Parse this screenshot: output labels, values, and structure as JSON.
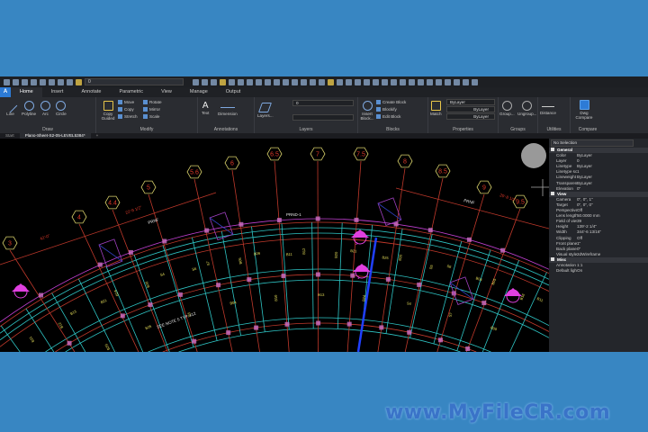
{
  "quick_access": {
    "layer_value": "0"
  },
  "ribbon_tabs": [
    "Home",
    "Insert",
    "Annotate",
    "Parametric",
    "View",
    "Manage",
    "Output"
  ],
  "app_button": "A",
  "ribbon": {
    "draw": {
      "label": "Draw",
      "line": "Line",
      "polyline": "Polyline",
      "arc": "Arc",
      "circle": "Circle"
    },
    "modify": {
      "label": "Modify",
      "copy_guided": "Copy Guided",
      "move": "Move",
      "copy": "Copy",
      "stretch": "Stretch",
      "rotate": "Rotate",
      "mirror": "Mirror",
      "scale": "Scale"
    },
    "annotations": {
      "label": "Annotations",
      "text": "Text",
      "dimension": "Dimension"
    },
    "layers": {
      "label": "Layers",
      "layers_btn": "Layers...",
      "layer_value": "0"
    },
    "blocks": {
      "label": "Blocks",
      "insert_block": "Insert Block...",
      "create_block": "Create Block",
      "blockify": "Blockify",
      "edit_block": "Edit Block"
    },
    "properties": {
      "label": "Properties",
      "match": "Match",
      "color": "ByLayer",
      "linetype": "ByLayer",
      "lineweight": "ByLayer"
    },
    "groups": {
      "label": "Groups",
      "group": "Group...",
      "ungroup": "Ungroup..."
    },
    "utilities": {
      "label": "Utilities",
      "distance": "Distance"
    },
    "compare": {
      "label": "Compare",
      "dwg_compare": "Dwg Compare"
    }
  },
  "doc_tabs": [
    "Start",
    "Plano-Sheet-S2-05-LEVEL5384*"
  ],
  "drawing": {
    "grid_bubbles": [
      "3",
      "4",
      "4.4",
      "5",
      "5.6",
      "6",
      "6.5",
      "7",
      "7.5",
      "8",
      "8.5",
      "9",
      "9.5"
    ],
    "notes": {
      "prnd": "PRND-1",
      "prnf": "PRNF",
      "see_note": "SEE NOTE 5 TYP. x12",
      "section1": "1",
      "section2": "2",
      "dim1": "42'-0\"",
      "dim2": "22'-9 1/2\"",
      "dim3": "20'-8 1/2\""
    },
    "beam_labels": [
      "B11",
      "B12",
      "B13",
      "B20",
      "B21",
      "B24",
      "B25",
      "B26",
      "S4",
      "S5",
      "S6",
      "S7",
      "B04",
      "B05",
      "B09",
      "B16"
    ]
  },
  "properties_panel": {
    "selection": "No Selection",
    "sections": [
      {
        "title": "General",
        "rows": [
          [
            "Color",
            "ByLayer"
          ],
          [
            "Layer",
            "0"
          ],
          [
            "Linetype",
            "ByLayer"
          ],
          [
            "Linetype scale",
            "1"
          ],
          [
            "Lineweight",
            "ByLayer"
          ],
          [
            "Transparency",
            "ByLayer"
          ],
          [
            "Elevation",
            "0\""
          ]
        ]
      },
      {
        "title": "View",
        "rows": [
          [
            "Camera",
            "0\", 0\", 1\""
          ],
          [
            "Target",
            "0\", 0\", 0\""
          ],
          [
            "Perspective",
            "Off"
          ],
          [
            "Lens length",
            "50.0000 mm"
          ],
          [
            "Field of view",
            "39"
          ],
          [
            "Height",
            "139'-2 1/4\""
          ],
          [
            "Width",
            "344'-6 13/16\""
          ],
          [
            "Clipping",
            "Off"
          ],
          [
            "Front plane",
            "1\""
          ],
          [
            "Back plane",
            "0\""
          ],
          [
            "Visual style",
            "2dWireframe"
          ]
        ]
      },
      {
        "title": "Misc",
        "rows": [
          [
            "Annotation sc",
            "1:1"
          ],
          [
            "Default lights",
            "On"
          ]
        ]
      }
    ]
  },
  "watermark": "www.MyFileCR.com"
}
